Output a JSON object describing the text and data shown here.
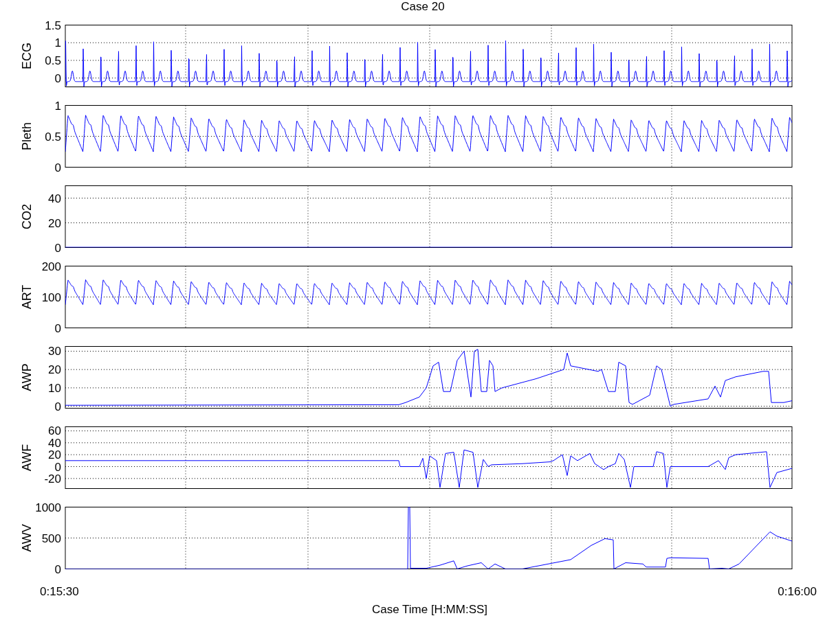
{
  "title": "Case 20",
  "panels": [
    {
      "kind": "ecg",
      "ylabel": "ECG",
      "yticks": [
        "1.5",
        "1",
        "0.5",
        "0"
      ]
    },
    {
      "kind": "pleth",
      "ylabel": "Pleth",
      "yticks": [
        "1",
        "0.5",
        "0"
      ]
    },
    {
      "kind": "co2",
      "ylabel": "CO2",
      "yticks": [
        "40",
        "20",
        "0"
      ]
    },
    {
      "kind": "art",
      "ylabel": "ART",
      "yticks": [
        "200",
        "100",
        "0"
      ]
    },
    {
      "kind": "awp",
      "ylabel": "AWP",
      "yticks": [
        "30",
        "20",
        "10",
        "0"
      ]
    },
    {
      "kind": "awf",
      "ylabel": "AWF",
      "yticks": [
        "60",
        "40",
        "20",
        "0",
        "-20"
      ]
    },
    {
      "kind": "awv",
      "ylabel": "AWV",
      "yticks": [
        "1000",
        "500",
        "0"
      ]
    }
  ],
  "xticks": [
    "0:15:30",
    "0:16:00"
  ],
  "xlabel": "Case Time [H:MM:SS]"
}
